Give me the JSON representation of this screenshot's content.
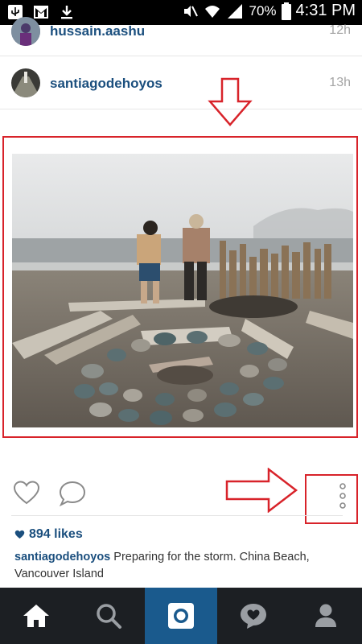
{
  "status_bar": {
    "battery": "70%",
    "time": "4:31 PM",
    "left_icons": [
      "usb-icon",
      "gmail-icon",
      "download-icon"
    ],
    "right_icons": [
      "mute-icon",
      "wifi-icon",
      "signal-icon",
      "battery-icon"
    ]
  },
  "feed": {
    "rows": [
      {
        "username": "hussain.aashu",
        "time": "12h"
      },
      {
        "username": "santiagodehoyos",
        "time": "13h"
      }
    ]
  },
  "post": {
    "likes": "894 likes",
    "caption_user": "santiagodehoyos",
    "caption_text": "Preparing for the storm. China Beach, Vancouver Island"
  },
  "tabs": [
    "home-icon",
    "search-icon",
    "camera-icon",
    "activity-icon",
    "profile-icon"
  ],
  "colors": {
    "accent": "#1b4f7e",
    "annotation_red": "#d8232a",
    "tabbar": "#1c1f23",
    "tab_active": "#1a5a8d"
  }
}
